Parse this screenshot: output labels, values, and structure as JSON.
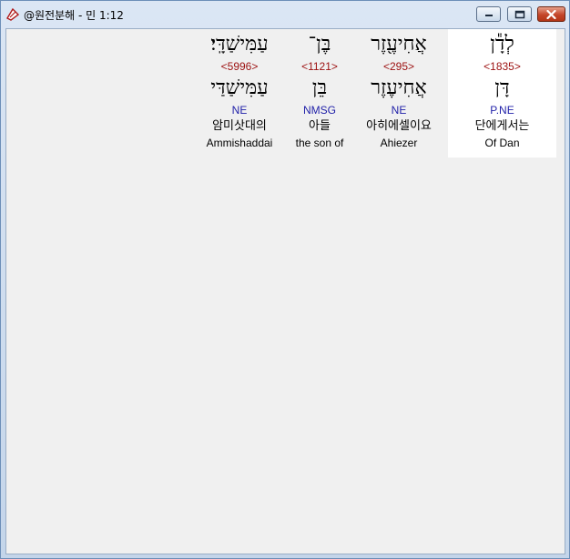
{
  "window": {
    "title": "@원전분해 - 민 1:12"
  },
  "words": [
    {
      "hebrew_top": "לְדָ֕ן",
      "strong": "<1835>",
      "hebrew_base": "דָּן",
      "morph": "P.NE",
      "korean": "단에게서는",
      "english": "Of Dan"
    },
    {
      "hebrew_top": "אֲחִיעֶ֖זֶר",
      "strong": "<295>",
      "hebrew_base": "אֲחִיעֶזֶר",
      "morph": "NE",
      "korean": "아히에셀이요",
      "english": "Ahiezer"
    },
    {
      "hebrew_top": "בֶּן־",
      "strong": "<1121>",
      "hebrew_base": "בֵּן",
      "morph": "NMSG",
      "korean": "아들",
      "english": "the son of"
    },
    {
      "hebrew_top": "עַמִּישַׁדָּֽי׃",
      "strong": "<5996>",
      "hebrew_base": "עַמִּישַׁדַּי",
      "morph": "NE",
      "korean": "암미삿대의",
      "english": "Ammishaddai"
    }
  ]
}
